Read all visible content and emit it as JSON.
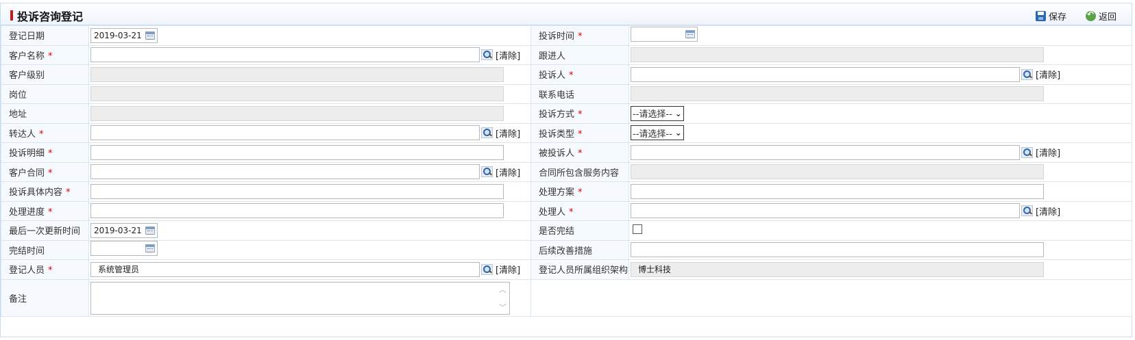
{
  "header": {
    "title": "投诉咨询登记",
    "save_label": "保存",
    "back_label": "返回"
  },
  "common": {
    "clear_label": "[清除]",
    "select_placeholder": "--请选择--"
  },
  "fields": {
    "reg_date": {
      "label": "登记日期",
      "value": "2019-03-21"
    },
    "complaint_time": {
      "label": "投诉时间"
    },
    "customer_name": {
      "label": "客户名称"
    },
    "follower": {
      "label": "跟进人"
    },
    "customer_level": {
      "label": "客户级别"
    },
    "complainant": {
      "label": "投诉人"
    },
    "position": {
      "label": "岗位"
    },
    "phone": {
      "label": "联系电话"
    },
    "address": {
      "label": "地址"
    },
    "complaint_method": {
      "label": "投诉方式",
      "value": "--请选择--"
    },
    "transferrer": {
      "label": "转达人"
    },
    "complaint_type": {
      "label": "投诉类型",
      "value": "--请选择--"
    },
    "complaint_detail": {
      "label": "投诉明细"
    },
    "complained_person": {
      "label": "被投诉人"
    },
    "customer_contract": {
      "label": "客户合同"
    },
    "contract_services": {
      "label": "合同所包含服务内容"
    },
    "complaint_content": {
      "label": "投诉具体内容"
    },
    "solution": {
      "label": "处理方案"
    },
    "progress": {
      "label": "处理进度"
    },
    "handler": {
      "label": "处理人"
    },
    "last_update": {
      "label": "最后一次更新时间",
      "value": "2019-03-21"
    },
    "is_completed": {
      "label": "是否完结"
    },
    "completion_time": {
      "label": "完结时间"
    },
    "improvement": {
      "label": "后续改善措施"
    },
    "registrar": {
      "label": "登记人员",
      "value": "系统管理员"
    },
    "registrar_org": {
      "label": "登记人员所属组织架构",
      "value": "博士科技"
    },
    "remarks": {
      "label": "备注"
    }
  },
  "colors": {
    "title_mark": "#c8161d",
    "required": "#d00000",
    "label_bg": "#f6f9fd",
    "border": "#d8e4f0"
  }
}
